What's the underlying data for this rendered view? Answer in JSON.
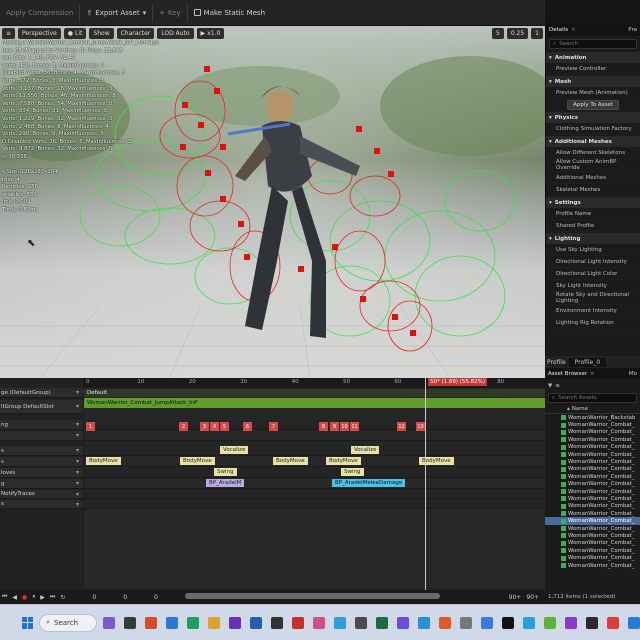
{
  "toolbar": {
    "apply_compression": "Apply Compression",
    "export_asset": "Export Asset",
    "key": "Key",
    "make_static_mesh": "Make Static Mesh"
  },
  "viewport": {
    "perspective": "Perspective",
    "lit": "Lit",
    "show": "Show",
    "character": "Character",
    "lod": "LOD Auto",
    "playback_rate": "x1.0",
    "right_controls": [
      "5",
      "0.25",
      "1"
    ],
    "stats": [
      "Montage WomanWarrior_Combat_JumpAttack_InP_Montage",
      "hes: 68 (Mapped to Vertices: 0) Polys: 53,643",
      "een Size: 1.148, FOV: 52.42",
      "Verts: 498, Bones: 3, MaxInfluences: 3",
      "Disabled Verts: 36, Bones: 4, MaxInfluences: 3",
      "Verts: 572, Bones: 3, MaxInfluences: 3",
      "Verts: 3,137, Bones: 16, MaxInfluences: 3",
      "Verts: 11,556, Bones: 46, MaxInfluences: 8",
      "Verts: 7,580, Bones: 54, MaxInfluences: 8",
      "Verts: 834, Bones: 31, MaxInfluences: 5",
      "Verts: 1,229, Bones: 32, MaxInfluences: 3",
      "Verts: 2,488, Bones: 8, MaxInfluences: 4",
      "Verts: 298, Bones: 9, MaxInfluences: 5",
      "D Disabled Verts: 36, Bones: 6, MaxInfluences: 3",
      "Verts: 9,872, Bones: 32, MaxInfluences: 5",
      "s: 38,338",
      "",
      "s Size: 126x287x184",
      "rder: 4",
      "Particles: 256",
      "ariables: 539",
      "ime: 0.009",
      "Time: 0.63ms"
    ]
  },
  "details": {
    "tab_details": "Details",
    "tab_preview": "Pre",
    "search_placeholder": "Search",
    "sections": [
      {
        "title": "Animation",
        "rows": [
          "Preview Controller"
        ]
      },
      {
        "title": "Mesh",
        "rows": [
          "Preview Mesh (Animation)"
        ],
        "button": "Apply To Asset"
      },
      {
        "title": "Physics",
        "rows": [
          "Clothing Simulation Factory"
        ]
      },
      {
        "title": "Additional Meshes",
        "rows": [
          "Allow Different Skeletons",
          "Allow Custom AnimBP Override",
          "Additional Meshes",
          "Skeletal Meshes"
        ]
      },
      {
        "title": "Settings",
        "rows": [
          "Profile Name",
          "Shared Profile"
        ]
      },
      {
        "title": "Lighting",
        "rows": [
          "Use Sky Lighting",
          "Directional Light Intensity",
          "Directional Light Color",
          "Sky Light Intensity",
          "Rotate Sky and Directional Lighting",
          "Environment Intensity",
          "Lighting Rig Rotation"
        ]
      }
    ],
    "profile_label": "Profile",
    "profile_value": "Profile_0"
  },
  "timeline": {
    "left_rows": [
      "ge (DefaultGroup)",
      "ltGroup DefaultSlot",
      "ng",
      "",
      "s",
      "s",
      "loves",
      "g",
      "NotifyTraces",
      "s"
    ],
    "ruler_numbers": [
      "0",
      "10",
      "20",
      "30",
      "40",
      "50",
      "60",
      "70",
      "80"
    ],
    "playhead_label": "50* (1.69) (55.82%)",
    "default_bar": "Default",
    "montage_bar": "WomanWarrior_Combat_JumpAttack_InP",
    "section_markers": [
      "1",
      "2",
      "3",
      "4",
      "5",
      "6",
      "7",
      "8",
      "9",
      "10",
      "11",
      "12",
      "13"
    ],
    "notifies": {
      "vocalize": "Vocalize",
      "body_move": "BodyMove",
      "swing": "Swing",
      "bp_aradel_short": "BP_AradelM",
      "bp_aradel_full": "BP_AradelMeleeDamage",
      "bp_aradel_short2": "BP_Arade"
    },
    "transport_values": [
      "0",
      "0",
      "0",
      "90+",
      "90+"
    ]
  },
  "asset_browser": {
    "tab_label": "Asset Browser",
    "tab_second": "Mo",
    "search_placeholder": "Search Assets",
    "column_name": "Name",
    "items": [
      "WomanWarrior_Backstab",
      "WomanWarrior_Combat_",
      "WomanWarrior_Combat_",
      "WomanWarrior_Combat_",
      "WomanWarrior_Combat_",
      "WomanWarrior_Combat_",
      "WomanWarrior_Combat_",
      "WomanWarrior_Combat_",
      "WomanWarrior_Combat_",
      "WomanWarrior_Combat_",
      "WomanWarrior_Combat_",
      "WomanWarrior_Combat_",
      "WomanWarrior_Combat_",
      "WomanWarrior_Combat_",
      "WomanWarrior_Combat_",
      "WomanWarrior_Combat_",
      "WomanWarrior_Combat_",
      "WomanWarrior_Combat_",
      "WomanWarrior_Combat_",
      "WomanWarrior_Combat_",
      "WomanWarrior_Combat_"
    ],
    "selected_index": 14,
    "count": "1,712 items (1 selected)"
  },
  "taskbar": {
    "search": "Search"
  },
  "colors": {
    "accent": "#4a6a9b",
    "montage_bar": "#5f9e2a",
    "section_marker": "#d34b4b",
    "notify_yellow": "#e8e1a6",
    "notify_purple": "#b9a8e8",
    "notify_cyan": "#47c3e6"
  }
}
